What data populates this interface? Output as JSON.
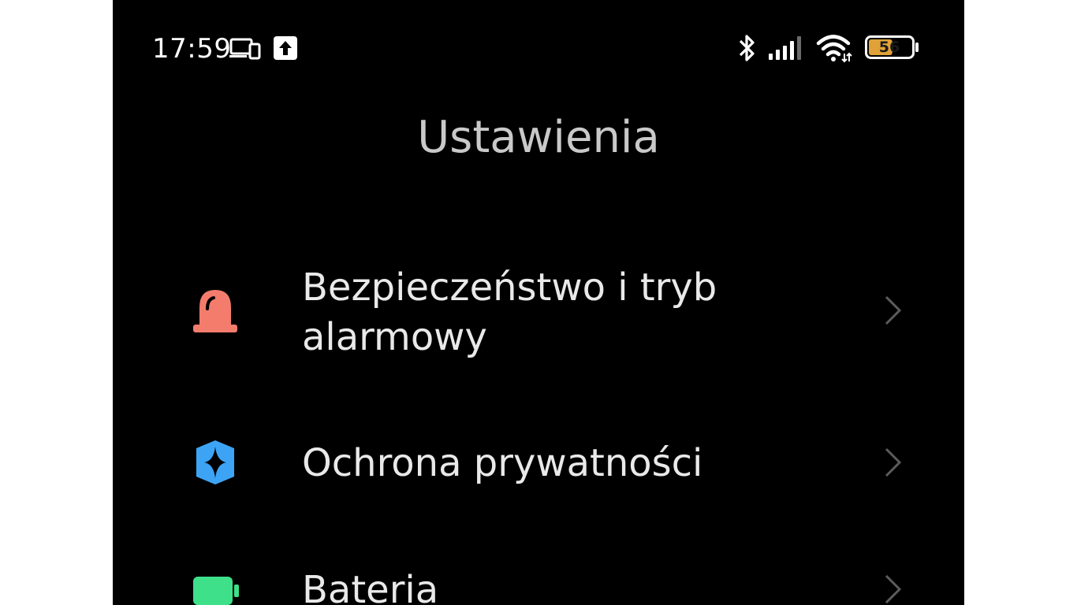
{
  "status_bar": {
    "time": "17:59",
    "battery_level": "56",
    "battery_fraction": 0.56,
    "icons": [
      "cast-icon",
      "upload-icon",
      "bluetooth-icon",
      "signal-icon",
      "wifi-icon",
      "battery-icon"
    ]
  },
  "header": {
    "title": "Ustawienia"
  },
  "settings": {
    "items": [
      {
        "label": "Bezpieczeństwo i tryb alarmowy",
        "icon": "emergency-siren-icon",
        "color": "#f47c6d"
      },
      {
        "label": "Ochrona prywatności",
        "icon": "privacy-shield-icon",
        "color": "#3da4f5"
      },
      {
        "label": "Bateria",
        "icon": "battery-icon",
        "color": "#3ee08a"
      }
    ]
  },
  "colors": {
    "background": "#000000",
    "text": "#e9e9e9",
    "title": "#c9c9c9",
    "chevron": "#5c5c5c",
    "battery_fill": "#e0a238"
  }
}
